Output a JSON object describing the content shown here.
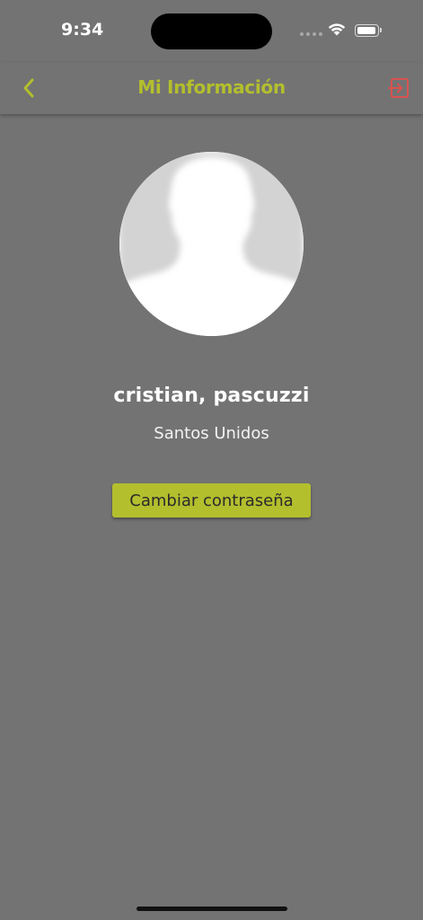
{
  "status_bar": {
    "time": "9:34"
  },
  "nav": {
    "title": "Mi Información",
    "back_icon": "chevron-left-icon",
    "logout_icon": "logout-icon"
  },
  "profile": {
    "avatar_icon": "user-silhouette-icon",
    "name": "cristian, pascuzzi",
    "organization": "Santos Unidos"
  },
  "actions": {
    "change_password_label": "Cambiar contraseña"
  },
  "colors": {
    "background": "#737373",
    "accent": "#b3bf2d",
    "logout": "#d9534f",
    "text_light": "#ffffff"
  }
}
